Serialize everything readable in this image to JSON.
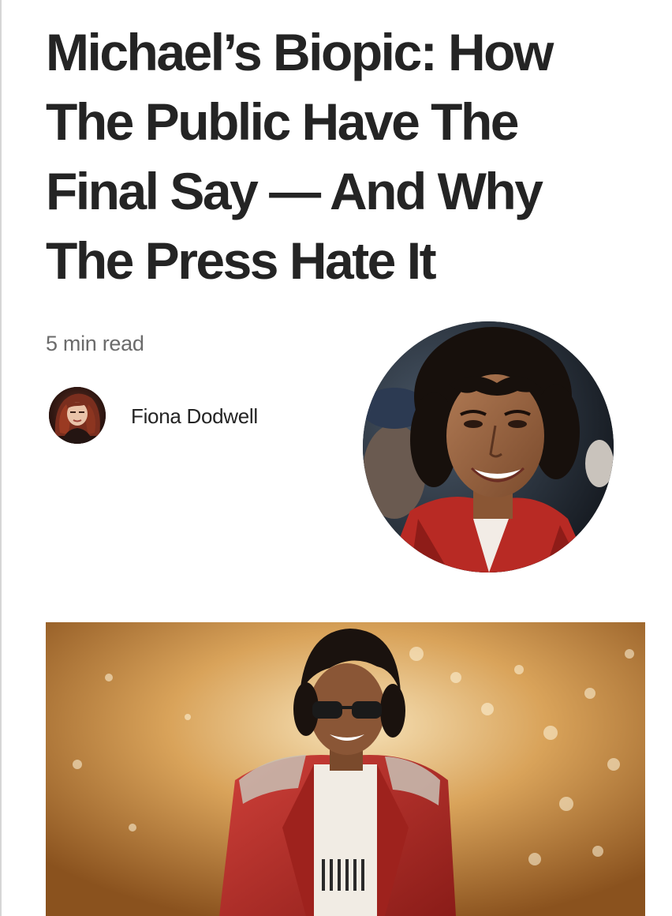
{
  "article": {
    "title": "Michael’s Biopic: How The Public Have The Final Say — And Why The Press Hate It",
    "read_time": "5 min read"
  },
  "author": {
    "name": "Fiona Dodwell"
  },
  "images": {
    "author_avatar": "author-avatar-photo",
    "portrait": "circular-portrait-photo",
    "hero": "hero-photo"
  },
  "colors": {
    "text": "#242424",
    "muted": "#6b6b6b",
    "jacket_red": "#c4312b",
    "hero_gold": "#c98a3e"
  }
}
